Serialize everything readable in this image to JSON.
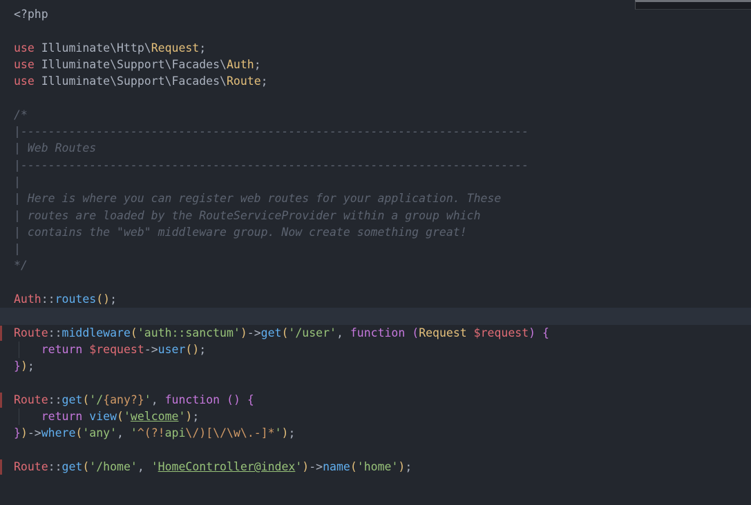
{
  "editor": {
    "language_shown": "php",
    "colors": {
      "background": "#23272e",
      "current_line_bg": "#2b313b",
      "foreground": "#abb2bf",
      "keyword_red": "#e06c75",
      "class_yellow": "#e5c07b",
      "function_blue": "#61afef",
      "string_green": "#98c379",
      "keyword_magenta": "#c678dd",
      "regex_orange": "#d19a66",
      "comment_gray": "#5c6370",
      "gutter_marker_red": "#8a3c3c"
    },
    "lines": [
      {
        "tokens": [
          [
            "<?php",
            "fg"
          ]
        ]
      },
      {
        "tokens": []
      },
      {
        "tokens": [
          [
            "use",
            "red"
          ],
          [
            " ",
            "fg"
          ],
          [
            "Illuminate\\Http\\",
            "fg"
          ],
          [
            "Request",
            "yel"
          ],
          [
            ";",
            "fg"
          ]
        ]
      },
      {
        "tokens": [
          [
            "use",
            "red"
          ],
          [
            " ",
            "fg"
          ],
          [
            "Illuminate\\Support\\Facades\\",
            "fg"
          ],
          [
            "Auth",
            "yel"
          ],
          [
            ";",
            "fg"
          ]
        ]
      },
      {
        "tokens": [
          [
            "use",
            "red"
          ],
          [
            " ",
            "fg"
          ],
          [
            "Illuminate\\Support\\Facades\\",
            "fg"
          ],
          [
            "Route",
            "yel"
          ],
          [
            ";",
            "fg"
          ]
        ]
      },
      {
        "tokens": []
      },
      {
        "tokens": [
          [
            "/*",
            "com"
          ]
        ]
      },
      {
        "tokens": [
          [
            "|--------------------------------------------------------------------------",
            "com"
          ]
        ]
      },
      {
        "tokens": [
          [
            "| Web Routes",
            "com"
          ]
        ]
      },
      {
        "tokens": [
          [
            "|--------------------------------------------------------------------------",
            "com"
          ]
        ]
      },
      {
        "tokens": [
          [
            "|",
            "com"
          ]
        ]
      },
      {
        "tokens": [
          [
            "| Here is where you can register web routes for your application. These",
            "com"
          ]
        ]
      },
      {
        "tokens": [
          [
            "| routes are loaded by the RouteServiceProvider within a group which",
            "com"
          ]
        ]
      },
      {
        "tokens": [
          [
            "| contains the \"web\" middleware group. Now create something great!",
            "com"
          ]
        ]
      },
      {
        "tokens": [
          [
            "|",
            "com"
          ]
        ]
      },
      {
        "tokens": [
          [
            "*/",
            "com"
          ]
        ]
      },
      {
        "tokens": []
      },
      {
        "tokens": [
          [
            "Auth",
            "red"
          ],
          [
            "::",
            "fg"
          ],
          [
            "routes",
            "blu"
          ],
          [
            "()",
            "yel"
          ],
          [
            ";",
            "fg"
          ]
        ]
      },
      {
        "hl": true,
        "tokens": []
      },
      {
        "marker": true,
        "tokens": [
          [
            "Route",
            "red"
          ],
          [
            "::",
            "fg"
          ],
          [
            "middleware",
            "blu"
          ],
          [
            "(",
            "yel"
          ],
          [
            "'auth::sanctum'",
            "grn"
          ],
          [
            ")",
            "yel"
          ],
          [
            "->",
            "fg"
          ],
          [
            "get",
            "blu"
          ],
          [
            "(",
            "yel"
          ],
          [
            "'/user'",
            "grn"
          ],
          [
            ", ",
            "fg"
          ],
          [
            "function",
            "mag"
          ],
          [
            " ",
            "fg"
          ],
          [
            "(",
            "mag"
          ],
          [
            "Request",
            "yel"
          ],
          [
            " ",
            "fg"
          ],
          [
            "$request",
            "red"
          ],
          [
            ")",
            "mag"
          ],
          [
            " ",
            "fg"
          ],
          [
            "{",
            "mag"
          ]
        ]
      },
      {
        "guide": true,
        "tokens": [
          [
            "    ",
            "fg"
          ],
          [
            "return",
            "mag"
          ],
          [
            " ",
            "fg"
          ],
          [
            "$request",
            "red"
          ],
          [
            "->",
            "fg"
          ],
          [
            "user",
            "blu"
          ],
          [
            "()",
            "yel"
          ],
          [
            ";",
            "fg"
          ]
        ]
      },
      {
        "tokens": [
          [
            "}",
            "mag"
          ],
          [
            ")",
            "yel"
          ],
          [
            ";",
            "fg"
          ]
        ]
      },
      {
        "tokens": []
      },
      {
        "marker": true,
        "tokens": [
          [
            "Route",
            "red"
          ],
          [
            "::",
            "fg"
          ],
          [
            "get",
            "blu"
          ],
          [
            "(",
            "yel"
          ],
          [
            "'/",
            "grn"
          ],
          [
            "{any?}",
            "org"
          ],
          [
            "'",
            "grn"
          ],
          [
            ", ",
            "fg"
          ],
          [
            "function",
            "mag"
          ],
          [
            " ",
            "fg"
          ],
          [
            "()",
            "mag"
          ],
          [
            " ",
            "fg"
          ],
          [
            "{",
            "mag"
          ]
        ]
      },
      {
        "guide": true,
        "tokens": [
          [
            "    ",
            "fg"
          ],
          [
            "return",
            "mag"
          ],
          [
            " ",
            "fg"
          ],
          [
            "view",
            "blu"
          ],
          [
            "(",
            "yel"
          ],
          [
            "'",
            "grn"
          ],
          [
            "welcome",
            "grn un"
          ],
          [
            "'",
            "grn"
          ],
          [
            ")",
            "yel"
          ],
          [
            ";",
            "fg"
          ]
        ]
      },
      {
        "tokens": [
          [
            "}",
            "mag"
          ],
          [
            ")",
            "yel"
          ],
          [
            "->",
            "fg"
          ],
          [
            "where",
            "blu"
          ],
          [
            "(",
            "yel"
          ],
          [
            "'any'",
            "grn"
          ],
          [
            ", ",
            "fg"
          ],
          [
            "'",
            "grn"
          ],
          [
            "^",
            "org"
          ],
          [
            "(?!",
            "org"
          ],
          [
            "api",
            "grn"
          ],
          [
            "\\/",
            "org"
          ],
          [
            ")",
            "org"
          ],
          [
            "[",
            "org"
          ],
          [
            "\\/\\w\\.-",
            "org"
          ],
          [
            "]",
            "org"
          ],
          [
            "*",
            "org"
          ],
          [
            "'",
            "grn"
          ],
          [
            ")",
            "yel"
          ],
          [
            ";",
            "fg"
          ]
        ]
      },
      {
        "tokens": []
      },
      {
        "marker": true,
        "tokens": [
          [
            "Route",
            "red"
          ],
          [
            "::",
            "fg"
          ],
          [
            "get",
            "blu"
          ],
          [
            "(",
            "yel"
          ],
          [
            "'/home'",
            "grn"
          ],
          [
            ", ",
            "fg"
          ],
          [
            "'",
            "grn"
          ],
          [
            "HomeController@index",
            "grn un"
          ],
          [
            "'",
            "grn"
          ],
          [
            ")",
            "yel"
          ],
          [
            "->",
            "fg"
          ],
          [
            "name",
            "blu"
          ],
          [
            "(",
            "yel"
          ],
          [
            "'home'",
            "grn"
          ],
          [
            ")",
            "yel"
          ],
          [
            ";",
            "fg"
          ]
        ]
      }
    ]
  },
  "overlay": {
    "description": "partial-floating-window-top-right"
  }
}
